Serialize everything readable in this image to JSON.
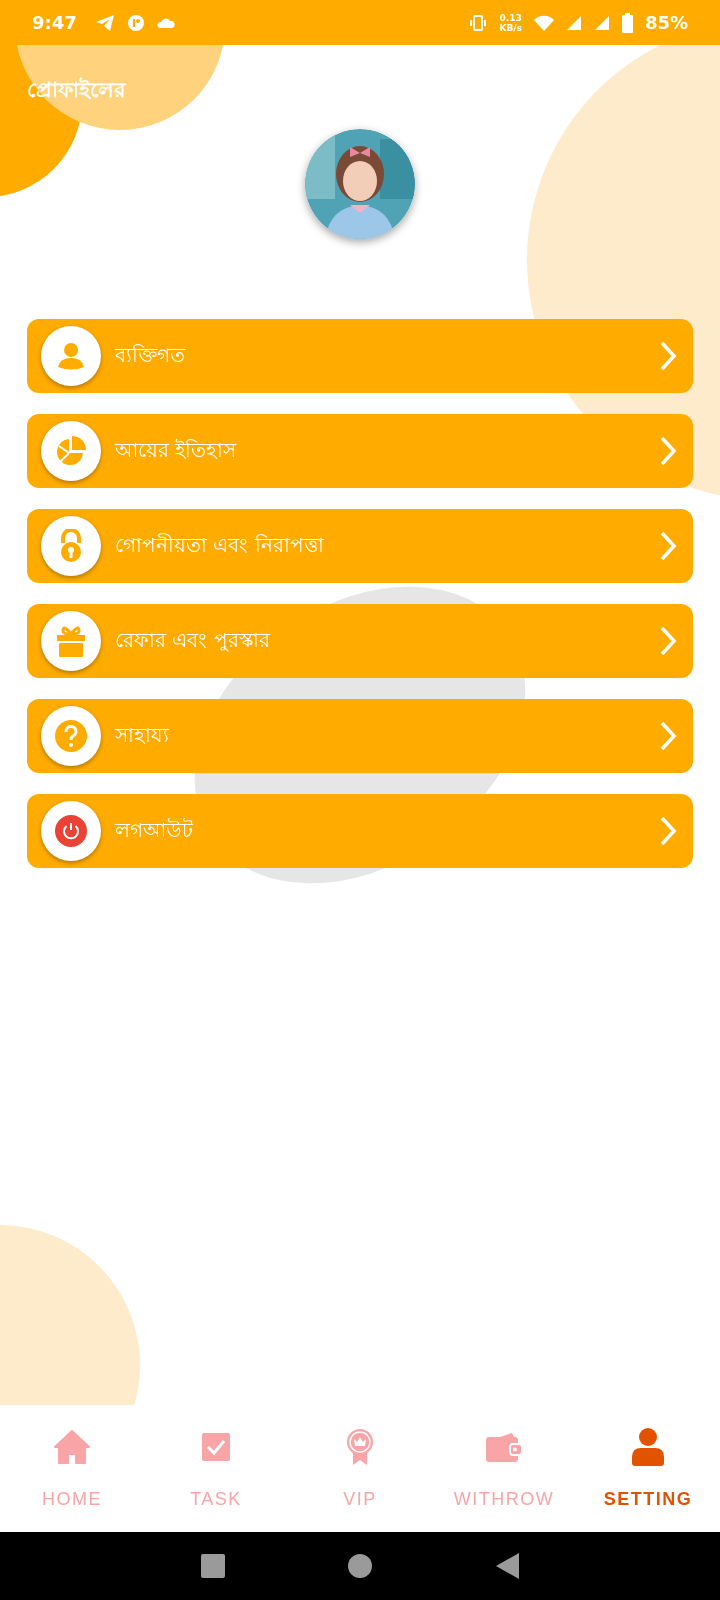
{
  "status_bar": {
    "time": "9:47",
    "net_speed": "0.13",
    "net_unit": "KB/s",
    "battery": "85%"
  },
  "header": {
    "title": "প্রোফাইলের"
  },
  "menu": [
    {
      "label": "ব্যক্তিগত",
      "kind": "person"
    },
    {
      "label": "আয়ের ইতিহাস",
      "kind": "chart"
    },
    {
      "label": "গোপনীয়তা এবং নিরাপত্তা",
      "kind": "lock"
    },
    {
      "label": "রেফার এবং পুরস্কার",
      "kind": "gift"
    },
    {
      "label": "সাহায্য",
      "kind": "help"
    },
    {
      "label": "লগআউট",
      "kind": "power"
    }
  ],
  "bottom_nav": [
    {
      "label": "HOME",
      "kind": "home",
      "selected": false
    },
    {
      "label": "TASK",
      "kind": "task",
      "selected": false
    },
    {
      "label": "VIP",
      "kind": "vip",
      "selected": false
    },
    {
      "label": "WITHROW",
      "kind": "wallet",
      "selected": false
    },
    {
      "label": "SETTING",
      "kind": "person",
      "selected": true
    }
  ]
}
